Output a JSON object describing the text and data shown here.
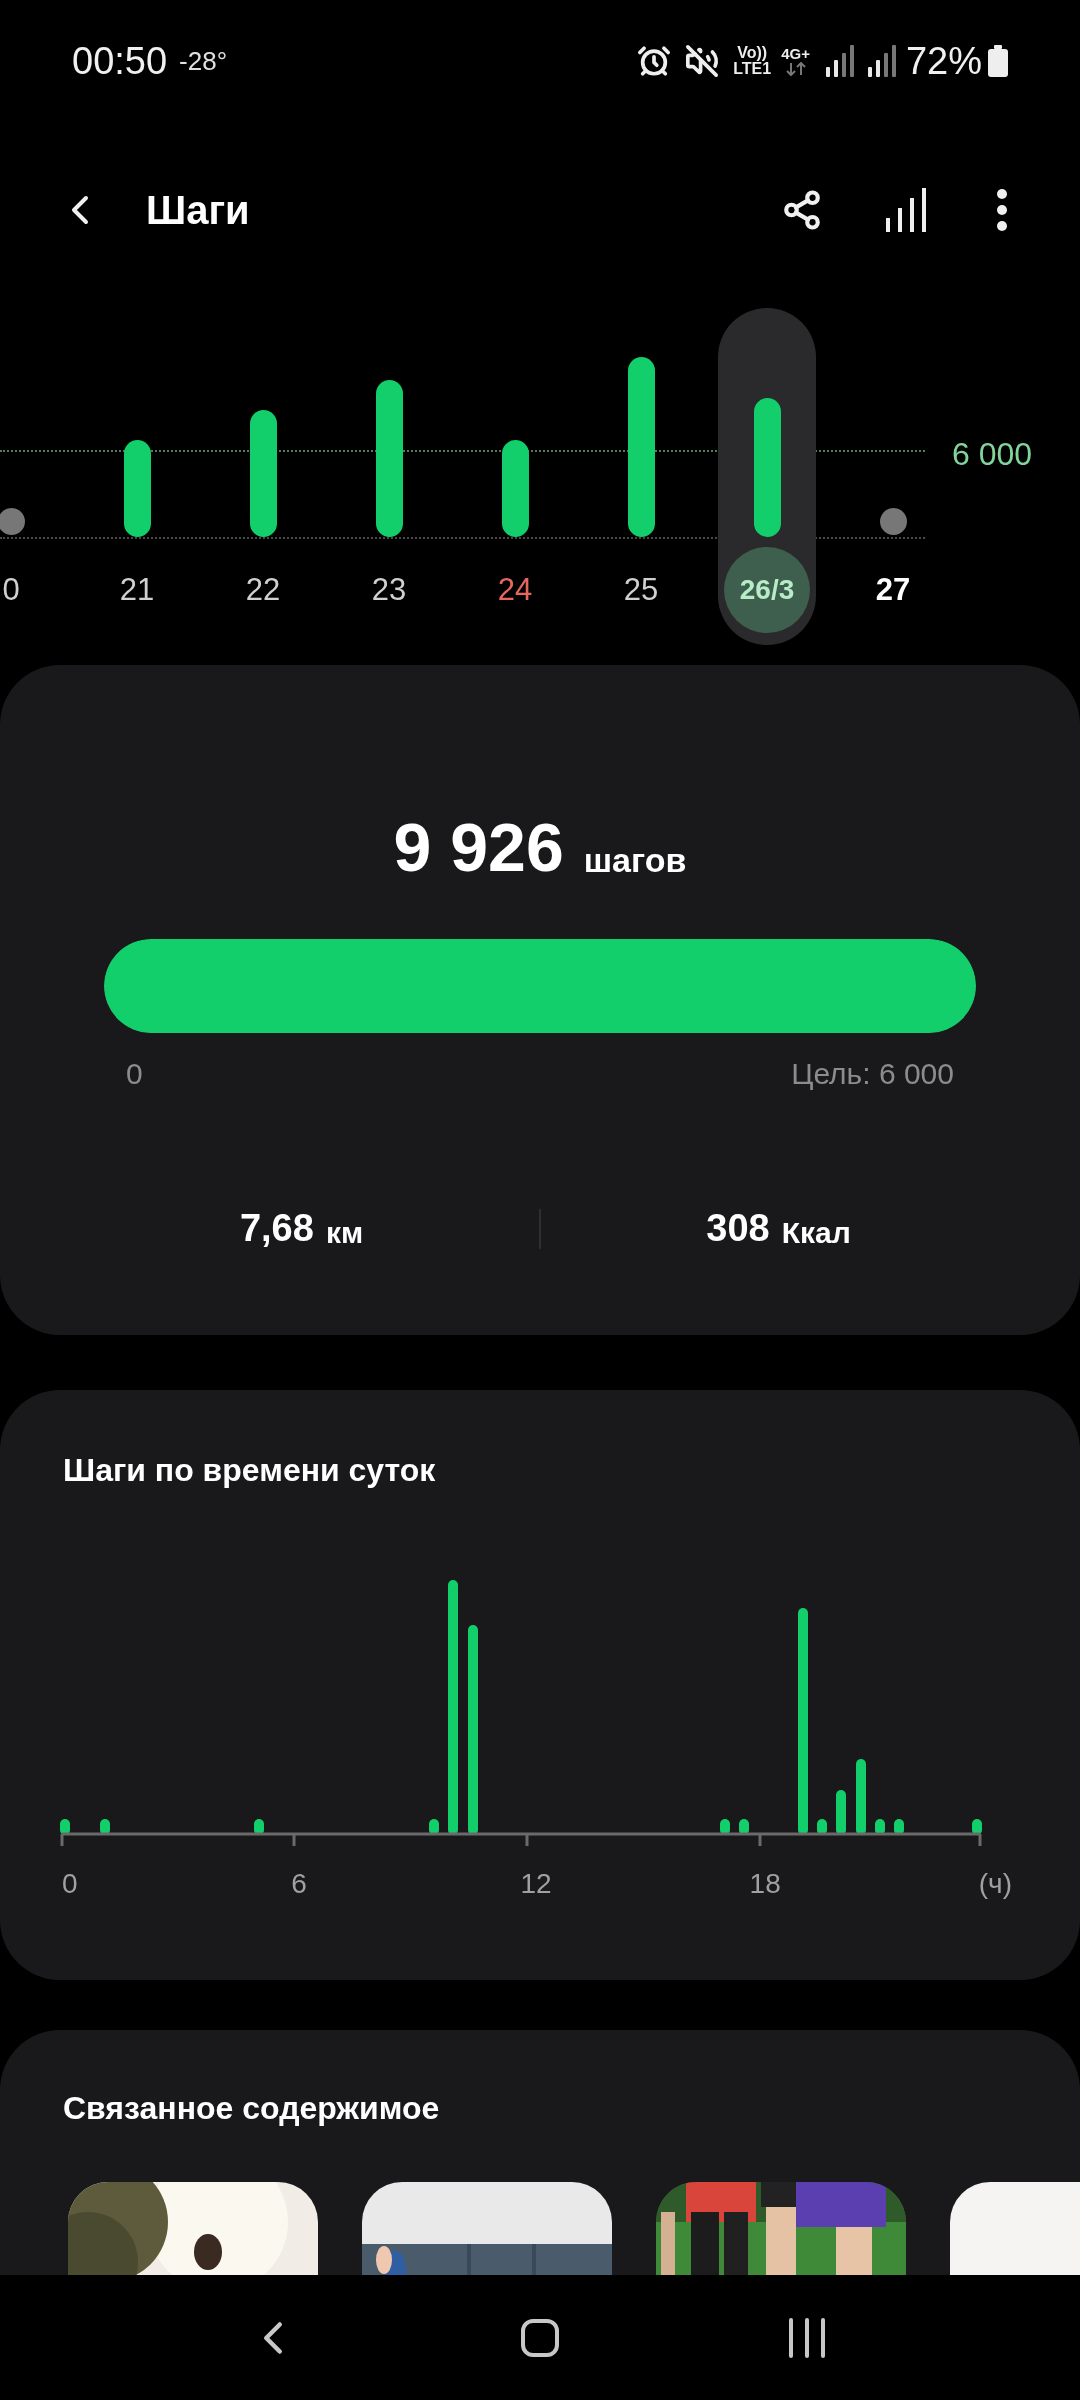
{
  "status_bar": {
    "time": "00:50",
    "temperature": "-28°",
    "volte": "Vo))",
    "lte": "LTE1",
    "network": "4G+",
    "battery": "72%"
  },
  "header": {
    "title": "Шаги"
  },
  "week_chart": {
    "goal_label": "6 000",
    "days": [
      {
        "label": "0",
        "kind": "dot",
        "selected": false,
        "today": false,
        "color": "#d0d0d0"
      },
      {
        "label": "21",
        "kind": "bar",
        "selected": false,
        "today": false,
        "color": "#d0d0d0"
      },
      {
        "label": "22",
        "kind": "bar",
        "selected": false,
        "today": false,
        "color": "#d0d0d0"
      },
      {
        "label": "23",
        "kind": "bar",
        "selected": false,
        "today": false,
        "color": "#d0d0d0"
      },
      {
        "label": "24",
        "kind": "bar",
        "selected": false,
        "today": false,
        "color": "#e5675f"
      },
      {
        "label": "25",
        "kind": "bar",
        "selected": false,
        "today": false,
        "color": "#d0d0d0"
      },
      {
        "label": "26/3",
        "kind": "bar",
        "selected": true,
        "today": false,
        "color": "#b8ecc9"
      },
      {
        "label": "27",
        "kind": "dot",
        "selected": false,
        "today": true,
        "color": "#ffffff"
      }
    ]
  },
  "summary": {
    "steps": "9 926",
    "steps_unit": "шагов",
    "progress": {
      "level": 1,
      "start_label": "0",
      "goal_label": "Цель: 6 000"
    },
    "distance": "7,68",
    "distance_unit": "км",
    "calories": "308",
    "calories_unit": "Ккал"
  },
  "hourly": {
    "title": "Шаги по времени суток",
    "x_labels": [
      "0",
      "6",
      "12",
      "18",
      "(ч)"
    ]
  },
  "related": {
    "title": "Связанное содержимое"
  }
}
